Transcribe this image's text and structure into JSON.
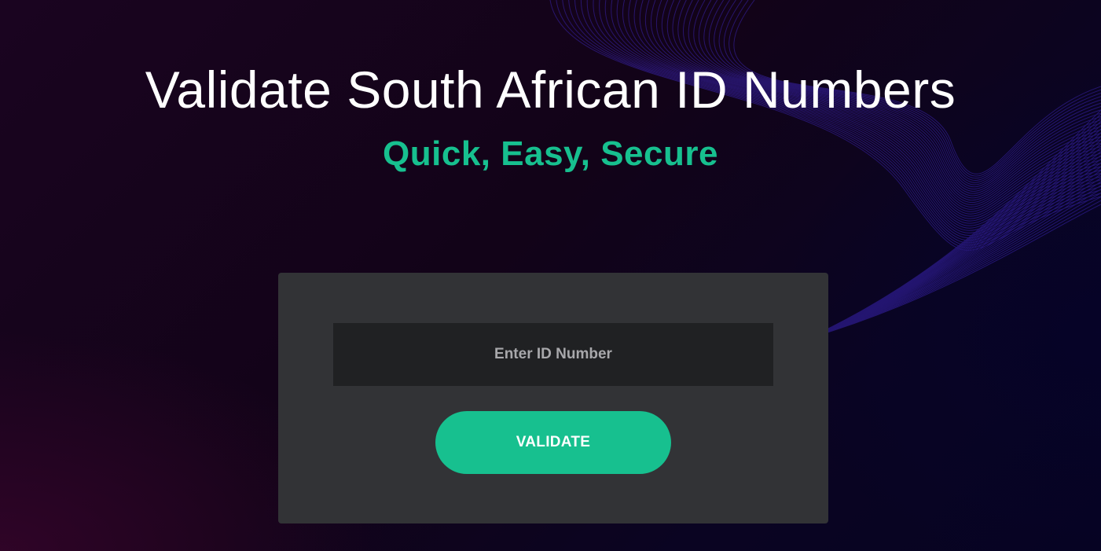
{
  "hero": {
    "title": "Validate South African ID Numbers",
    "subtitle": "Quick, Easy, Secure"
  },
  "form": {
    "id_input": {
      "value": "",
      "placeholder": "Enter ID Number"
    },
    "validate_label": "VALIDATE"
  },
  "colors": {
    "accent": "#17c08f",
    "card_background": "#323336",
    "input_background": "#202123",
    "page_background": "#130414",
    "wave_lines": "#2a1a8a"
  },
  "icons": {
    "background": "wave-lines-decoration"
  }
}
